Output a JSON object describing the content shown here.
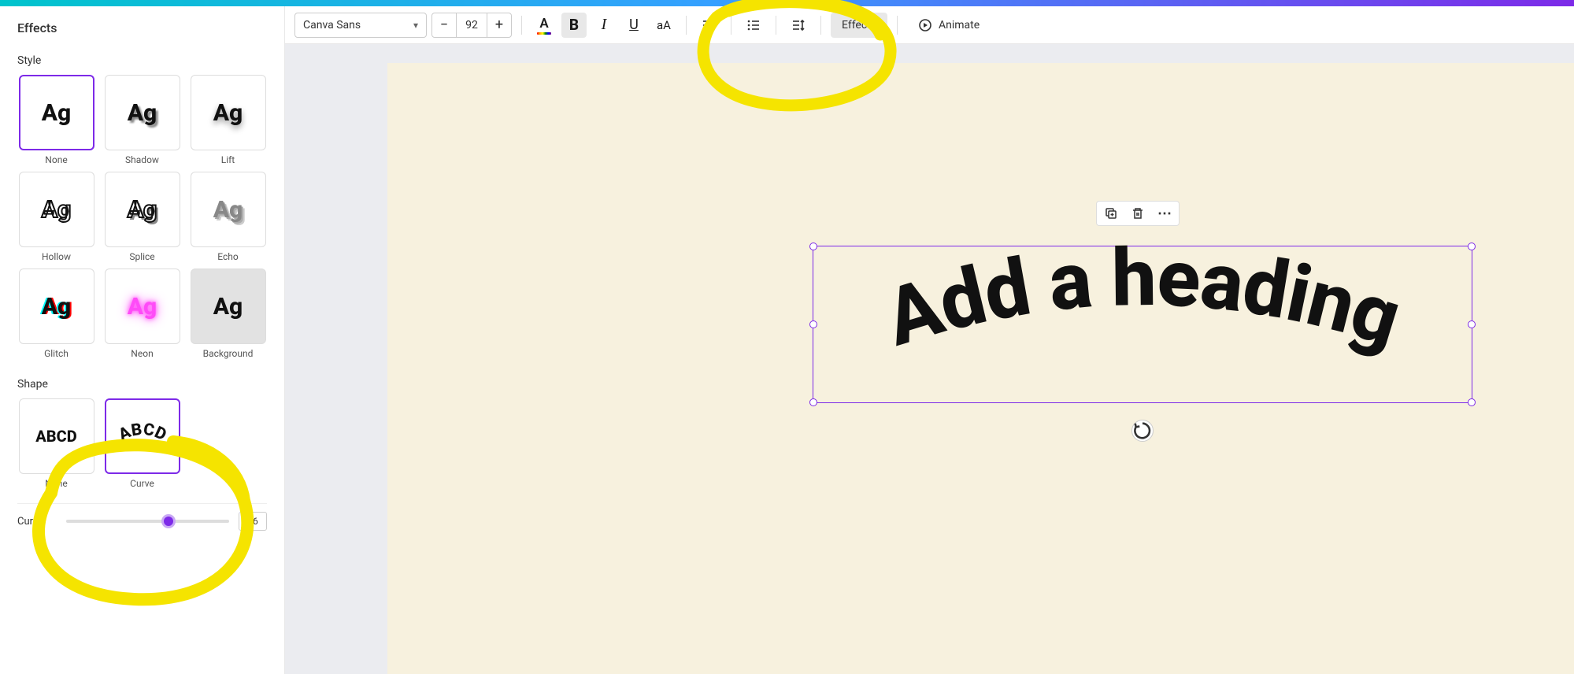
{
  "sidebar": {
    "title": "Effects",
    "style_label": "Style",
    "shape_label": "Shape",
    "effects": [
      {
        "label": "None",
        "sample": "Ag"
      },
      {
        "label": "Shadow",
        "sample": "Ag"
      },
      {
        "label": "Lift",
        "sample": "Ag"
      },
      {
        "label": "Hollow",
        "sample": "Ag"
      },
      {
        "label": "Splice",
        "sample": "Ag"
      },
      {
        "label": "Echo",
        "sample": "Ag"
      },
      {
        "label": "Glitch",
        "sample": "Ag"
      },
      {
        "label": "Neon",
        "sample": "Ag"
      },
      {
        "label": "Background",
        "sample": "Ag"
      }
    ],
    "shapes": [
      {
        "label": "None",
        "sample": "ABCD"
      },
      {
        "label": "Curve",
        "sample": "ABCD"
      }
    ],
    "curve": {
      "label": "Curve",
      "value": "26"
    }
  },
  "toolbar": {
    "font_name": "Canva Sans",
    "font_size": "92",
    "minus": "−",
    "plus": "+",
    "effects_label": "Effects",
    "animate_label": "Animate",
    "color_letter": "A",
    "bold": "B",
    "italic": "I",
    "underline": "U",
    "case": "aA"
  },
  "canvas": {
    "text_content": "Add a heading"
  },
  "floating": {
    "more": "⋯"
  }
}
